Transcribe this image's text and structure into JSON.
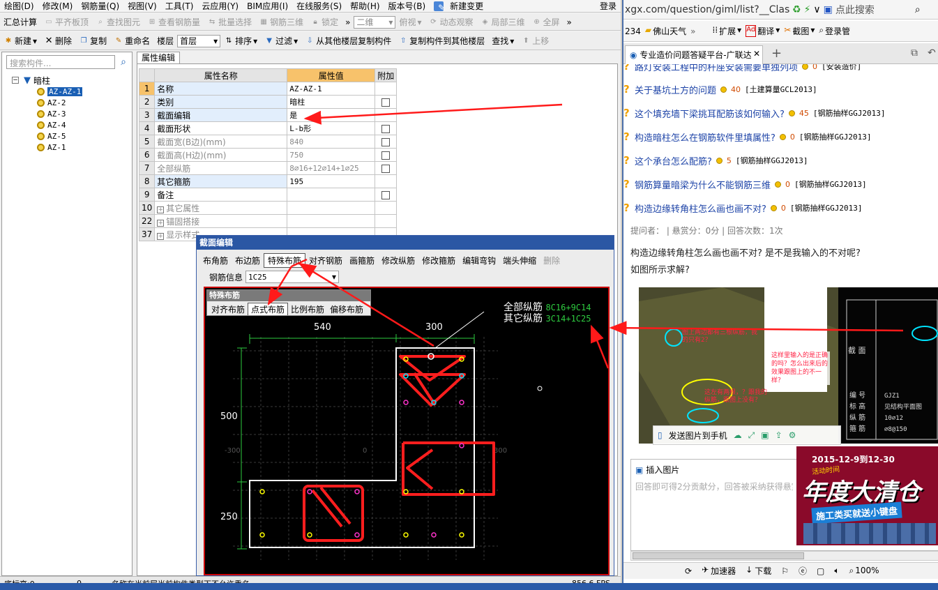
{
  "left": {
    "menu": [
      "绘图(D)",
      "修改(M)",
      "钢筋量(Q)",
      "视图(V)",
      "工具(T)",
      "云应用(Y)",
      "BIM应用(I)",
      "在线服务(S)",
      "帮助(H)",
      "版本号(B)",
      "新建变更"
    ],
    "login": "登录",
    "toolbar1": {
      "summary": "汇总计算",
      "items": [
        "平齐板顶",
        "查找图元",
        "查看钢筋量",
        "批量选择",
        "钢筋三维",
        "锁定"
      ],
      "view_combo": "二维",
      "items2": [
        "俯视",
        "动态观察",
        "局部三维",
        "全屏"
      ]
    },
    "toolbar2": {
      "new": "新建",
      "delete": "删除",
      "copy": "复制",
      "rename": "重命名",
      "floor_label": "楼层",
      "floor_value": "首层",
      "sort": "排序",
      "filter": "过滤",
      "copy_from": "从其他楼层复制构件",
      "copy_to": "复制构件到其他楼层",
      "find": "查找",
      "move_up": "上移"
    },
    "tree": {
      "search_placeholder": "搜索构件...",
      "root": "暗柱",
      "items": [
        "AZ-AZ-1",
        "AZ-2",
        "AZ-3",
        "AZ-4",
        "AZ-5",
        "AZ-1"
      ]
    },
    "prop_tab": "属性编辑",
    "props": {
      "headers": [
        "属性名称",
        "属性值",
        "附加"
      ],
      "rows": [
        {
          "n": "1",
          "name": "名称",
          "value": "AZ-AZ-1"
        },
        {
          "n": "2",
          "name": "类别",
          "value": "暗柱"
        },
        {
          "n": "3",
          "name": "截面编辑",
          "value": "是"
        },
        {
          "n": "4",
          "name": "截面形状",
          "value": "L-b形"
        },
        {
          "n": "5",
          "name": "截面宽(B边)(mm)",
          "value": "840"
        },
        {
          "n": "6",
          "name": "截面高(H边)(mm)",
          "value": "750"
        },
        {
          "n": "7",
          "name": "全部纵筋",
          "value": "8⌀16+12⌀14+1⌀25"
        },
        {
          "n": "8",
          "name": "其它箍筋",
          "value": "195"
        },
        {
          "n": "9",
          "name": "备注",
          "value": ""
        },
        {
          "n": "10",
          "name": "其它属性",
          "value": ""
        },
        {
          "n": "22",
          "name": "锚固搭接",
          "value": ""
        },
        {
          "n": "37",
          "name": "显示样式",
          "value": ""
        }
      ]
    },
    "status": [
      "底标高:0",
      "0",
      "名称在当前层当前构件类型下不允许重名",
      "856.6 FPS"
    ]
  },
  "dialog": {
    "title": "截面编辑",
    "toolbar": [
      "布角筋",
      "布边筋",
      "特殊布筋",
      "对齐钢筋",
      "画箍筋",
      "修改纵筋",
      "修改箍筋",
      "编辑弯钩",
      "端头伸缩",
      "删除"
    ],
    "info_label": "钢筋信息",
    "info_value": "1C25",
    "special": {
      "title": "特殊布筋",
      "buttons": [
        "对齐布筋",
        "点式布筋",
        "比例布筋",
        "偏移布筋"
      ]
    },
    "canvas": {
      "all_label": "全部纵筋",
      "all_value": "8C16+9C14",
      "other_label": "其它纵筋",
      "other_value": "3C14+1C25",
      "dims": {
        "top_left": "540",
        "top_right": "300",
        "left_top": "500",
        "left_bottom": "250"
      },
      "coords": [
        "-300",
        "0",
        "300"
      ]
    }
  },
  "right": {
    "address": "xgx.com/question/giml/list?__ClassCod",
    "search_placeholder": "点此搜索",
    "bookmarks": [
      "234",
      "佛山天气",
      "扩展",
      "翻译",
      "截图",
      "登录管"
    ],
    "tab_title": "专业造价问题答疑平台-广联达",
    "questions": [
      {
        "t": "路灯安装工程中的杆座安装需要单独列项",
        "s": "0",
        "tag": "[安装造价]"
      },
      {
        "t": "关于基坑土方的问题",
        "s": "40",
        "tag": "[土建算量GCL2013]"
      },
      {
        "t": "这个填充墙下梁挑耳配筋该如何输入?",
        "s": "45",
        "tag": "[钢筋抽样GGJ2013]"
      },
      {
        "t": "构造暗柱怎么在钢筋软件里填属性?",
        "s": "0",
        "tag": "[钢筋抽样GGJ2013]"
      },
      {
        "t": "这个承台怎么配筋?",
        "s": "5",
        "tag": "[钢筋抽样GGJ2013]"
      },
      {
        "t": "钢筋算量暗梁为什么不能钢筋三维",
        "s": "0",
        "tag": "[钢筋抽样GGJ2013]"
      },
      {
        "t": "构造边缘转角柱怎么画也画不对?",
        "s": "0",
        "tag": "[钢筋抽样GGJ2013]"
      }
    ],
    "meta": "提问者：  |  悬赏分：0分  |  回答次数：1次",
    "question_text": [
      "构造边缘转角柱怎么画也画不对? 是不是我输入的不对呢?",
      "如图所示求解?"
    ],
    "thumb": {
      "section": "截 面",
      "labels": [
        "编 号",
        "标 高",
        "纵 筋",
        "箍 筋"
      ],
      "values": [
        "GJZ1",
        "见结构平面图",
        "10⌀12",
        "⌀8@150"
      ],
      "note1": "图上两边都有三根纵筋，我的只有2？",
      "note2": "这样里输入的是正确的吗？怎么出来后的效果跟图上的不一样？",
      "note3": "这左有两根，？跟我的纵筋，跟图上没有？"
    },
    "send_photo": "发送图片到手机",
    "insert_image": "插入图片",
    "reply_placeholder": "回答即可得2分贡献分，回答被采纳获得悬赏",
    "ad": {
      "date": "2015-12-9到12-30",
      "sub": "活动时间",
      "big": "年度大清仓",
      "tag": "施工类买就送小键盘"
    },
    "status": [
      "加速器",
      "下载",
      "100%"
    ]
  },
  "colors": {
    "accent": "#2b57a4",
    "arrow": "#ff1a1a",
    "rebar": "#ff1e1e",
    "link": "#1f45a8"
  }
}
